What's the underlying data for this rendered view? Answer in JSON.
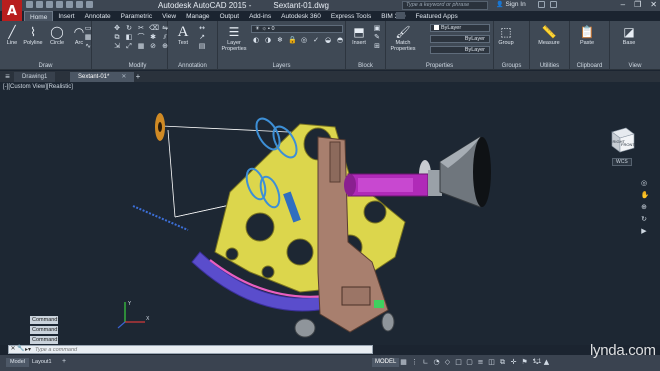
{
  "titlebar": {
    "app_logo": "A",
    "app_title": "Autodesk AutoCAD 2015 -",
    "file_name": "Sextant-01.dwg",
    "search_placeholder": "Type a keyword or phrase",
    "signin": "Sign In"
  },
  "ribbon_tabs": [
    "Home",
    "Insert",
    "Annotate",
    "Parametric",
    "View",
    "Manage",
    "Output",
    "Add-ins",
    "Autodesk 360",
    "Express Tools",
    "BIM 360",
    "Featured Apps"
  ],
  "ribbon": {
    "draw": {
      "label": "Draw",
      "tools": [
        "Line",
        "Polyline",
        "Circle",
        "Arc"
      ]
    },
    "modify": {
      "label": "Modify"
    },
    "annotation": {
      "label": "Annotation",
      "text_tool": "Text"
    },
    "layers": {
      "label": "Layers",
      "props_tool": "Layer Properties",
      "layer_value": "0"
    },
    "block": {
      "label": "Block",
      "insert_tool": "Insert"
    },
    "properties": {
      "label": "Properties",
      "match_tool": "Match Properties",
      "color": "ByLayer",
      "linetype": "ByLayer",
      "lineweight": "ByLayer"
    },
    "groups": {
      "label": "Groups",
      "group_tool": "Group"
    },
    "utilities": {
      "label": "Utilities",
      "measure_tool": "Measure"
    },
    "clipboard": {
      "label": "Clipboard",
      "paste_tool": "Paste"
    },
    "view": {
      "label": "View",
      "base_tool": "Base"
    }
  },
  "file_tabs": [
    {
      "label": "Drawing1"
    },
    {
      "label": "Sextant-01*"
    }
  ],
  "viewport": {
    "view_label": "[-][Custom View][Realistic]",
    "viewcube_front": "FRONT",
    "viewcube_right": "RIGHT",
    "wcs": "WCS",
    "command_history": [
      "Command:",
      "Command:",
      "Command:"
    ]
  },
  "command_line": {
    "placeholder": "Type a command"
  },
  "status": {
    "layout_tabs": [
      "Model",
      "Layout1"
    ],
    "model_label": "MODEL",
    "scale": "1:1"
  },
  "watermark": "lynda.com",
  "colors": {
    "accent": "#b81e1e",
    "viewport_bg": "#1d2733",
    "frame_yellow": "#e8e35a",
    "arm_brown": "#a87f6e",
    "scope_magenta": "#b02ab8",
    "arc_blue": "#5046c8",
    "lens_blue": "#3d8fd6"
  }
}
